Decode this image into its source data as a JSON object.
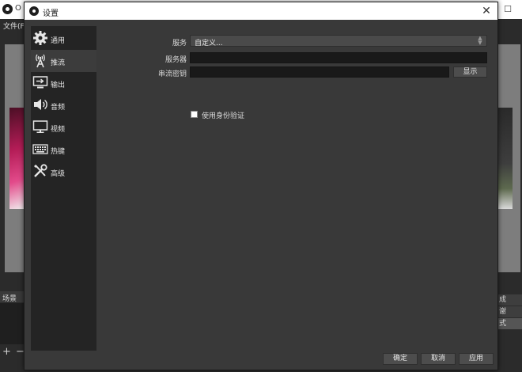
{
  "main_window": {
    "title": "O",
    "menu_file": "文件(F",
    "minimize_glyph": "—",
    "maximize_glyph": "☐",
    "scenes_label": "场景",
    "add_glyph": "+",
    "remove_glyph": "−",
    "controls": [
      "成",
      "谢",
      "式"
    ]
  },
  "dialog": {
    "title": "设置",
    "close_glyph": "✕"
  },
  "sidebar": {
    "items": [
      {
        "label": "通用",
        "icon": "gear-icon",
        "selected": false
      },
      {
        "label": "推流",
        "icon": "broadcast-antenna-icon",
        "selected": true
      },
      {
        "label": "输出",
        "icon": "output-monitor-icon",
        "selected": false
      },
      {
        "label": "音频",
        "icon": "speaker-icon",
        "selected": false
      },
      {
        "label": "视频",
        "icon": "monitor-icon",
        "selected": false
      },
      {
        "label": "热键",
        "icon": "keyboard-icon",
        "selected": false
      },
      {
        "label": "高级",
        "icon": "tools-icon",
        "selected": false
      }
    ]
  },
  "stream": {
    "service_label": "服务",
    "service_value": "自定义...",
    "server_label": "服务器",
    "server_value": "",
    "stream_key_label": "串流密钥",
    "stream_key_value": "",
    "show_button": "显示",
    "auth_checkbox_label": "使用身份验证",
    "auth_checked": false
  },
  "footer": {
    "ok": "确定",
    "cancel": "取消",
    "apply": "应用"
  }
}
